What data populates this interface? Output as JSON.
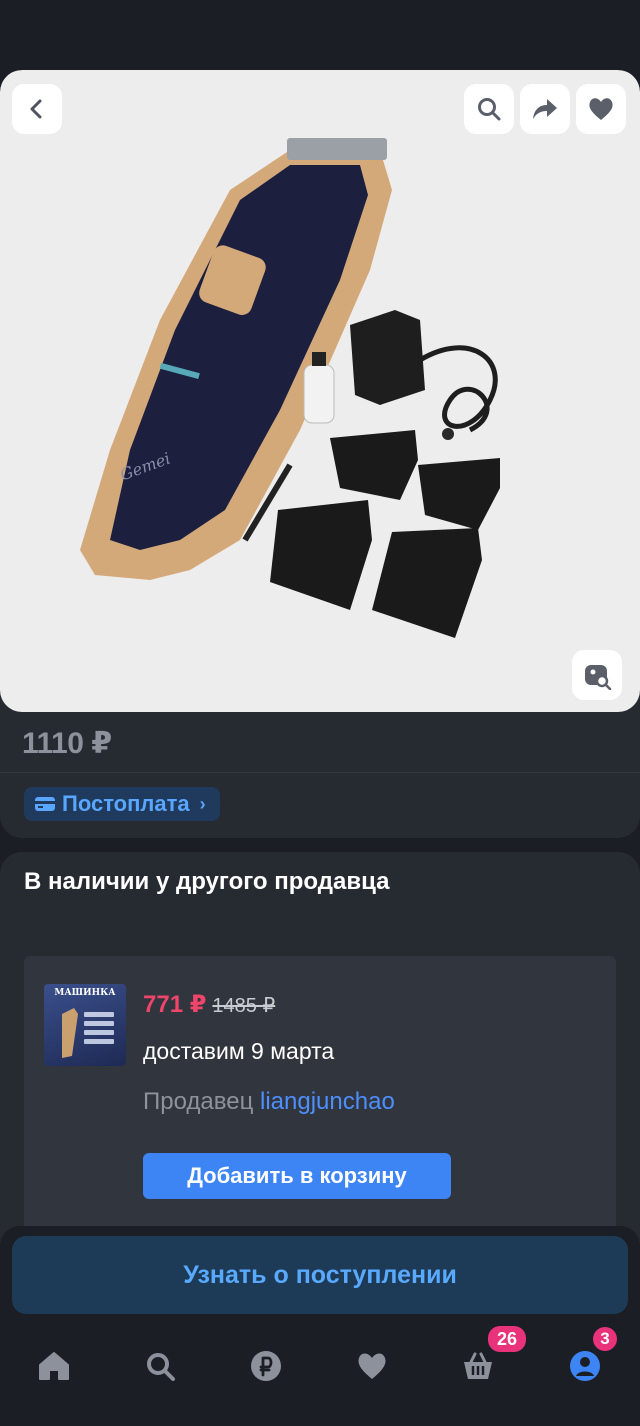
{
  "product": {
    "price": "1110 ₽",
    "postpay_label": "Постоплата",
    "image_brand_text": "Gemei"
  },
  "seller_section": {
    "title": "В наличии у другого продавца",
    "offer": {
      "thumbnail_caption": "МАШИНКА",
      "price": "771 ₽",
      "old_price": "1485 ₽",
      "delivery": "доставим 9 марта",
      "seller_label": "Продавец",
      "seller_name": "liangjunchao",
      "add_to_cart_label": "Добавить в корзину"
    }
  },
  "notify_button_label": "Узнать о поступлении",
  "tab_bar": {
    "items": [
      {
        "icon": "home-icon"
      },
      {
        "icon": "search-icon"
      },
      {
        "icon": "ruble-icon"
      },
      {
        "icon": "heart-icon"
      },
      {
        "icon": "basket-icon"
      },
      {
        "icon": "profile-icon"
      }
    ],
    "cart_badge": "26",
    "profile_badge": "3"
  },
  "colors": {
    "background": "#1b1e25",
    "card": "#262a31",
    "accent_blue": "#3d84f4",
    "sale_price": "#f0456b",
    "badge_pink": "#e8327a"
  }
}
